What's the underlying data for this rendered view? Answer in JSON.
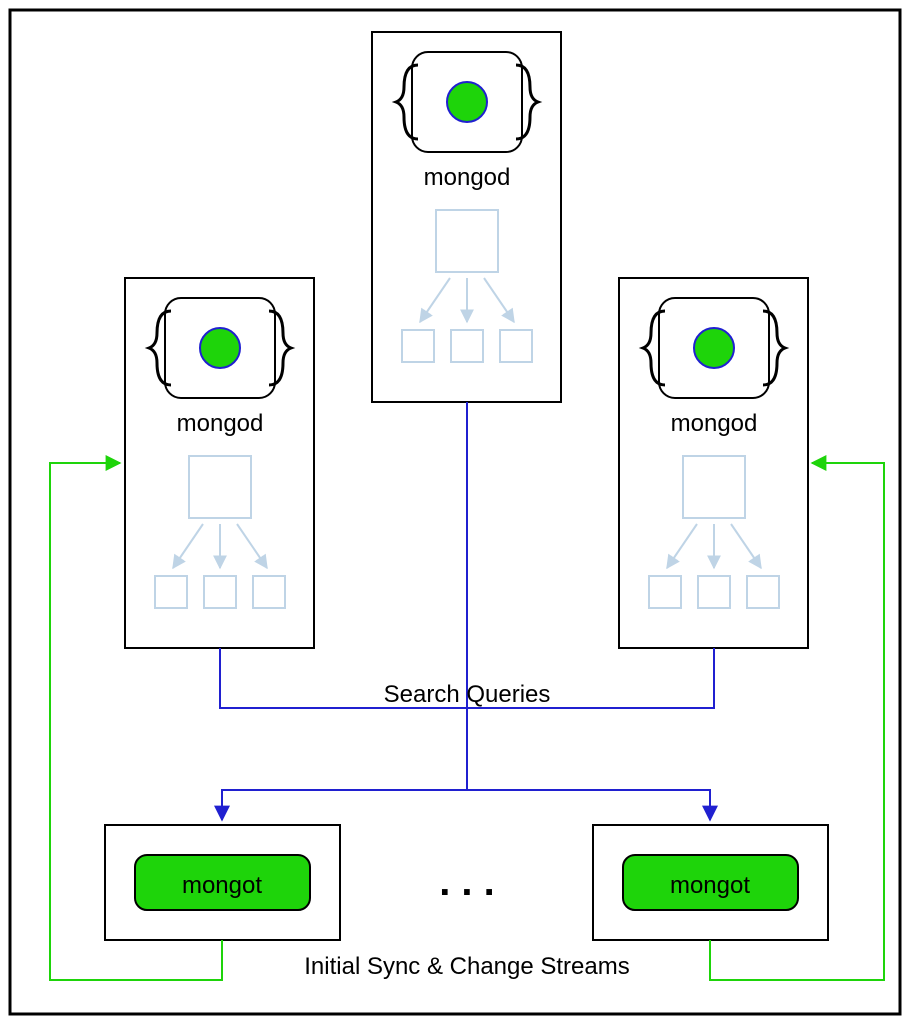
{
  "nodes": {
    "mongod_top": {
      "label": "mongod"
    },
    "mongod_left": {
      "label": "mongod"
    },
    "mongod_right": {
      "label": "mongod"
    },
    "mongot_left": {
      "label": "mongot"
    },
    "mongot_right": {
      "label": "mongot"
    }
  },
  "captions": {
    "search_queries": "Search  Queries",
    "sync_streams": "Initial Sync & Change Streams",
    "ellipsis": ". . ."
  },
  "colors": {
    "green": "#1ED40A",
    "blue": "#2020D0",
    "faint": "#BFD4E6",
    "black": "#000"
  }
}
